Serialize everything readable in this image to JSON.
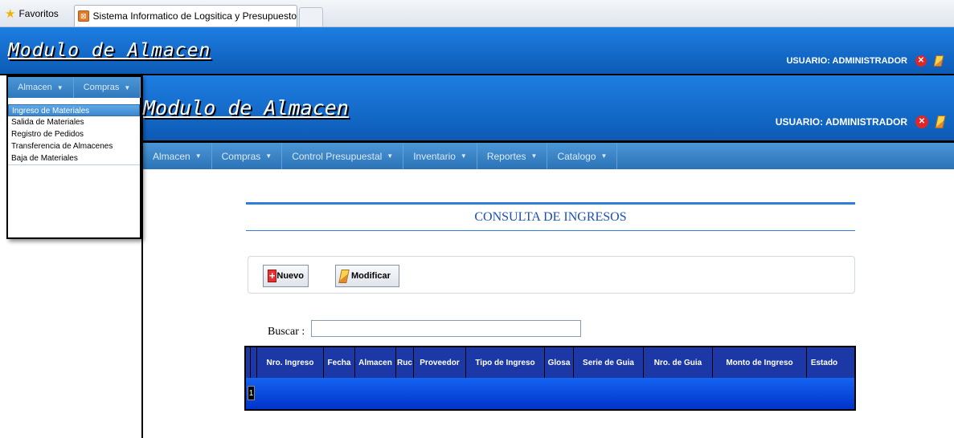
{
  "browser": {
    "favorites_label": "Favoritos",
    "tab_title": "Sistema Informatico de Logsitica y Presupuesto"
  },
  "outer": {
    "title": "Modulo de Almacen",
    "user_label": "USUARIO: ADMINISTRADOR"
  },
  "left_menu": {
    "bar": [
      "Almacen",
      "Compras"
    ],
    "items": [
      {
        "label": "Ingreso de Materiales",
        "active": true
      },
      {
        "label": "Salida de Materiales"
      },
      {
        "label": "Registro de Pedidos"
      },
      {
        "label": "Transferencia de Almacenes"
      },
      {
        "label": "Baja de Materiales"
      }
    ]
  },
  "inner": {
    "title": "Modulo de Almacen",
    "user_label": "USUARIO: ADMINISTRADOR",
    "nav": [
      "Almacen",
      "Compras",
      "Control Presupuestal",
      "Inventario",
      "Reportes",
      "Catalogo"
    ]
  },
  "content": {
    "section_title": "CONSULTA DE INGRESOS",
    "btn_nuevo": "Nuevo",
    "btn_modificar": "Modificar",
    "search_label": "Buscar  :",
    "search_value": "",
    "grid": {
      "columns": [
        "Nro. Ingreso",
        "Fecha",
        "Almacen",
        "Ruc",
        "Proveedor",
        "Tipo de Ingreso",
        "Glosa",
        "Serie de Guia",
        "Nro. de Guia",
        "Monto de Ingreso",
        "Estado"
      ],
      "pager": "1"
    }
  },
  "colors": {
    "header_blue": "#1e7ee2",
    "nav_blue": "#2f78bd",
    "grid_blue": "#0044dd",
    "title_blue": "#1a4fb8"
  }
}
